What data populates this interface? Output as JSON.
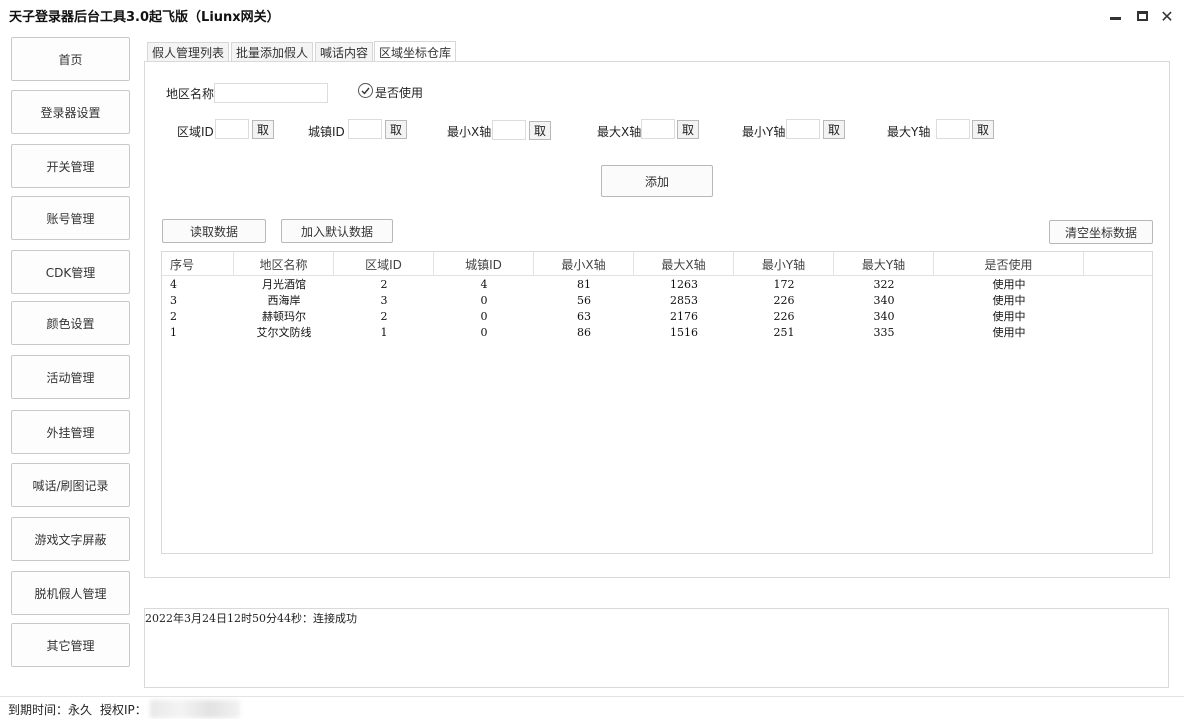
{
  "window": {
    "title": "天子登录器后台工具3.0起飞版（Liunx网关）",
    "minimize_icon": "minimize-icon",
    "maximize_icon": "maximize-icon",
    "close_glyph": "✕"
  },
  "sidebar": {
    "items": [
      {
        "label": "首页"
      },
      {
        "label": "登录器设置"
      },
      {
        "label": "开关管理"
      },
      {
        "label": "账号管理"
      },
      {
        "label": "CDK管理"
      },
      {
        "label": "颜色设置"
      },
      {
        "label": "活动管理"
      },
      {
        "label": "外挂管理"
      },
      {
        "label": "喊话/刷图记录"
      },
      {
        "label": "游戏文字屏蔽"
      },
      {
        "label": "脱机假人管理"
      },
      {
        "label": "其它管理"
      }
    ]
  },
  "tabs": [
    {
      "label": "假人管理列表"
    },
    {
      "label": "批量添加假人"
    },
    {
      "label": "喊话内容"
    },
    {
      "label": "区域坐标仓库",
      "active": true
    }
  ],
  "form": {
    "region_name_label": "地区名称",
    "region_name_value": "",
    "enabled_label": "是否使用",
    "enabled_checked": true,
    "fields": [
      {
        "label": "区域ID",
        "value": "",
        "fetch_label": "取"
      },
      {
        "label": "城镇ID",
        "value": "",
        "fetch_label": "取"
      },
      {
        "label": "最小X轴",
        "value": "",
        "fetch_label": "取"
      },
      {
        "label": "最大X轴",
        "value": "",
        "fetch_label": "取"
      },
      {
        "label": "最小Y轴",
        "value": "",
        "fetch_label": "取"
      },
      {
        "label": "最大Y轴",
        "value": "",
        "fetch_label": "取"
      }
    ],
    "add_label": "添加"
  },
  "actions": {
    "read_label": "读取数据",
    "default_label": "加入默认数据",
    "clear_label": "清空坐标数据"
  },
  "table": {
    "headers": [
      "序号",
      "地区名称",
      "区域ID",
      "城镇ID",
      "最小X轴",
      "最大X轴",
      "最小Y轴",
      "最大Y轴",
      "是否使用"
    ],
    "rows": [
      [
        "4",
        "月光酒馆",
        "2",
        "4",
        "81",
        "1263",
        "172",
        "322",
        "使用中"
      ],
      [
        "3",
        "西海岸",
        "3",
        "0",
        "56",
        "2853",
        "226",
        "340",
        "使用中"
      ],
      [
        "2",
        "赫顿玛尔",
        "2",
        "0",
        "63",
        "2176",
        "226",
        "340",
        "使用中"
      ],
      [
        "1",
        "艾尔文防线",
        "1",
        "0",
        "86",
        "1516",
        "251",
        "335",
        "使用中"
      ]
    ]
  },
  "log": {
    "text": "2022年3月24日12时50分44秒：连接成功"
  },
  "status": {
    "expiry_label": "到期时间：",
    "expiry_value": "永久",
    "ip_label": "授权IP："
  }
}
